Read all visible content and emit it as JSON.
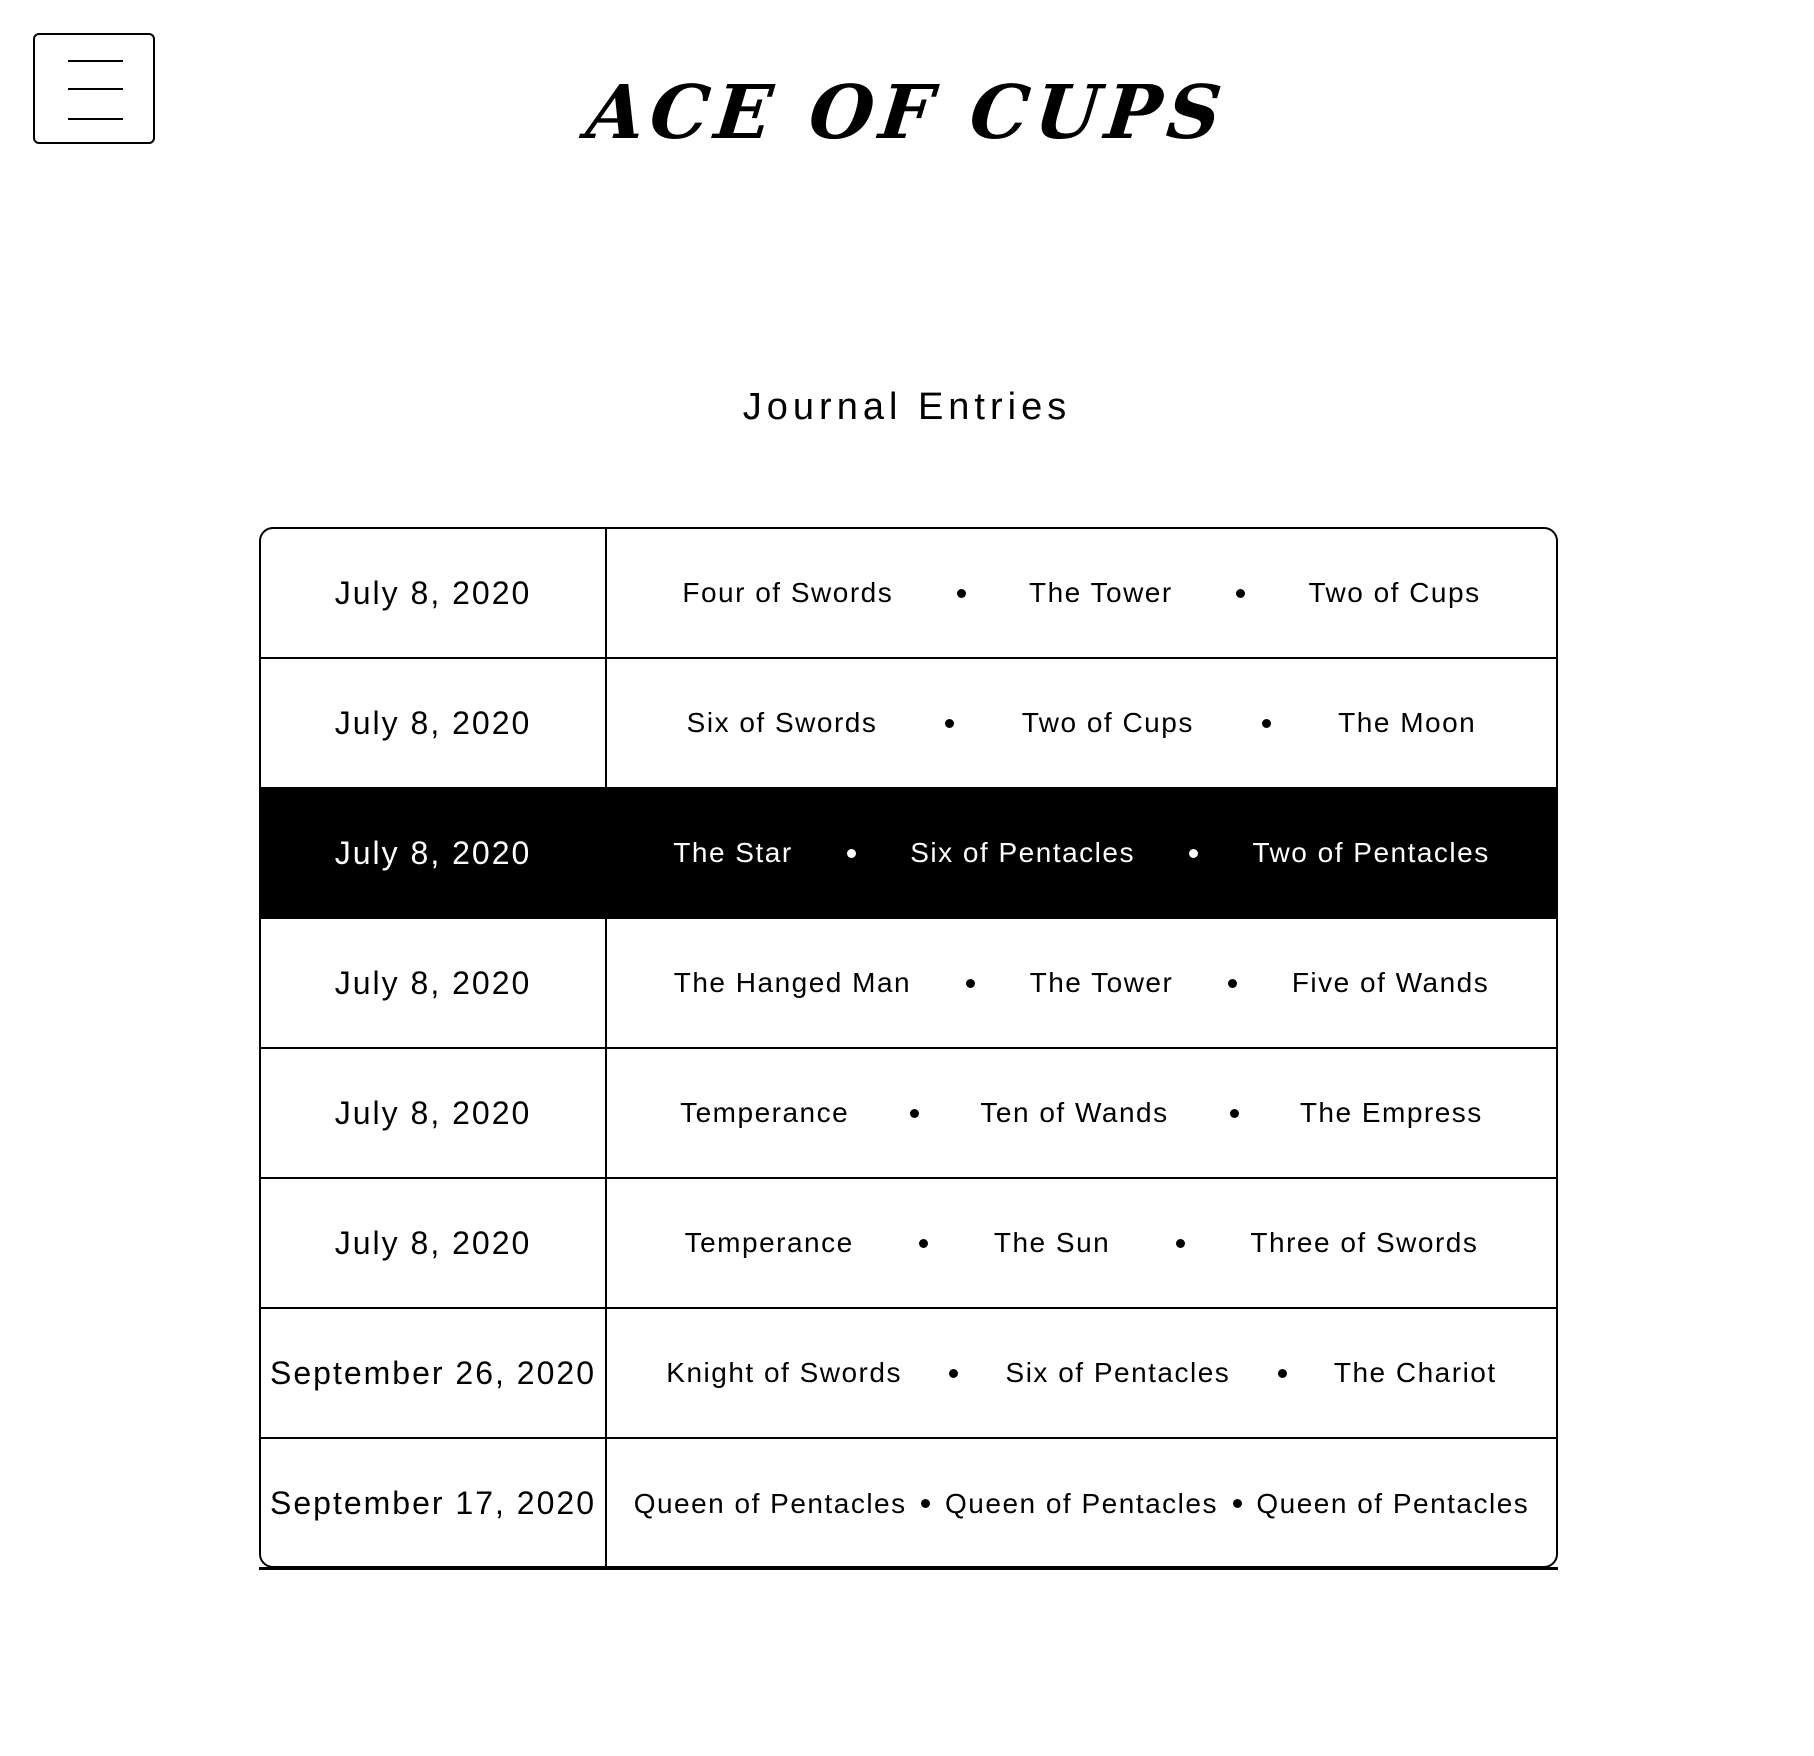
{
  "header": {
    "menu_icon": "hamburger-menu-icon",
    "logo_text": "ACE OF CUPS"
  },
  "main": {
    "title": "Journal Entries",
    "separator_icon": "bullet-icon",
    "colors": {
      "highlight_background": "#000000",
      "highlight_text": "#ffffff",
      "border": "#000000"
    },
    "entries": [
      {
        "date": "July 8, 2020",
        "cards": [
          "Four of Swords",
          "The Tower",
          "Two of Cups"
        ],
        "highlighted": false
      },
      {
        "date": "July 8, 2020",
        "cards": [
          "Six of Swords",
          "Two of Cups",
          "The Moon"
        ],
        "highlighted": false
      },
      {
        "date": "July 8, 2020",
        "cards": [
          "The Star",
          "Six of Pentacles",
          "Two of Pentacles"
        ],
        "highlighted": true
      },
      {
        "date": "July 8, 2020",
        "cards": [
          "The Hanged Man",
          "The Tower",
          "Five of Wands"
        ],
        "highlighted": false
      },
      {
        "date": "July 8, 2020",
        "cards": [
          "Temperance",
          "Ten of Wands",
          "The Empress"
        ],
        "highlighted": false
      },
      {
        "date": "July 8, 2020",
        "cards": [
          "Temperance",
          "The Sun",
          "Three of Swords"
        ],
        "highlighted": false
      },
      {
        "date": "September 26, 2020",
        "cards": [
          "Knight of Swords",
          "Six of Pentacles",
          "The Chariot"
        ],
        "highlighted": false
      },
      {
        "date": "September 17, 2020",
        "cards": [
          "Queen of Pentacles",
          "Queen of Pentacles",
          "Queen of Pentacles"
        ],
        "highlighted": false
      }
    ]
  }
}
